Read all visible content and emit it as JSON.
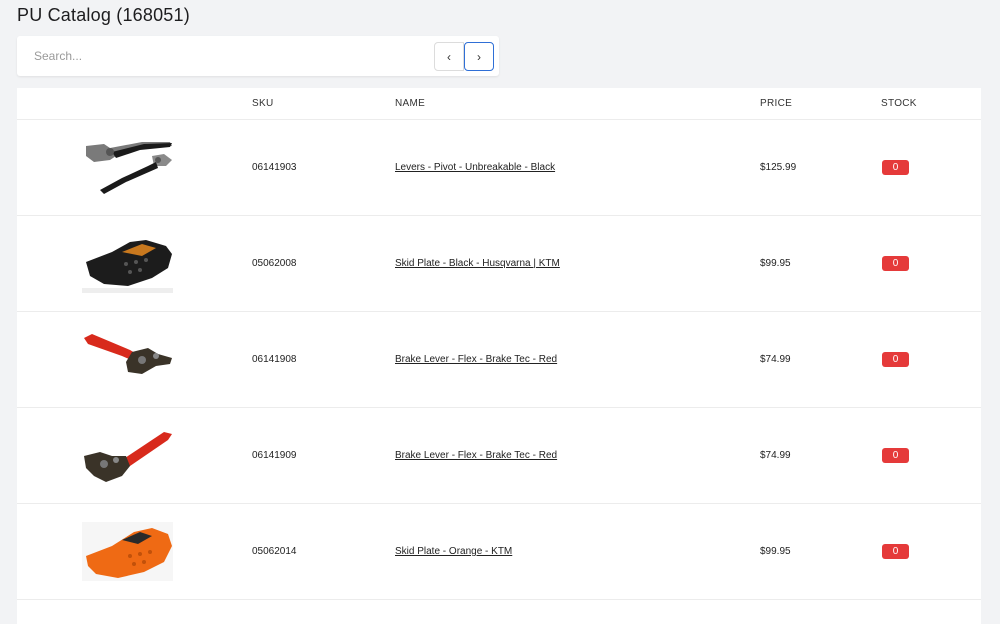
{
  "page": {
    "title": "PU Catalog (168051)"
  },
  "search": {
    "placeholder": "Search...",
    "prev_label": "‹",
    "next_label": "›"
  },
  "table": {
    "headers": {
      "image": "",
      "sku": "SKU",
      "name": "NAME",
      "price": "PRICE",
      "stock": "STOCK"
    },
    "rows": [
      {
        "sku": "06141903",
        "name": "Levers - Pivot - Unbreakable - Black",
        "price": "$125.99",
        "stock": "0",
        "image": "black-levers-image"
      },
      {
        "sku": "05062008",
        "name": "Skid Plate - Black - Husqvarna | KTM",
        "price": "$99.95",
        "stock": "0",
        "image": "black-skid-plate-image"
      },
      {
        "sku": "06141908",
        "name": "Brake Lever - Flex - Brake Tec - Red",
        "price": "$74.99",
        "stock": "0",
        "image": "red-brake-lever-image"
      },
      {
        "sku": "06141909",
        "name": "Brake Lever - Flex - Brake Tec - Red",
        "price": "$74.99",
        "stock": "0",
        "image": "red-brake-lever-image"
      },
      {
        "sku": "05062014",
        "name": "Skid Plate - Orange - KTM",
        "price": "$99.95",
        "stock": "0",
        "image": "orange-skid-plate-image"
      }
    ]
  },
  "colors": {
    "stock_badge": "#e53a3a",
    "accent": "#2f6fd6",
    "background": "#f2f3f5"
  }
}
